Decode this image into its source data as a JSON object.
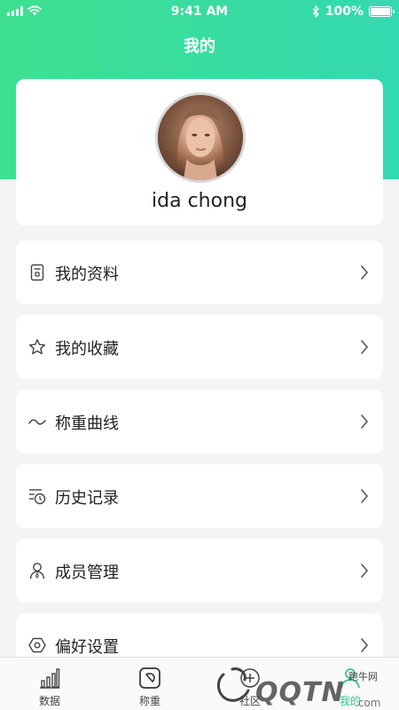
{
  "status_bar": {
    "time": "9:41 AM",
    "battery": "100%",
    "battery_level": 1.0
  },
  "header": {
    "title": "我的"
  },
  "profile": {
    "username": "ida chong"
  },
  "menu": [
    {
      "label": "我的资料",
      "icon": "profile-document-icon"
    },
    {
      "label": "我的收藏",
      "icon": "star-icon"
    },
    {
      "label": "称重曲线",
      "icon": "wave-curve-icon"
    },
    {
      "label": "历史记录",
      "icon": "history-clock-icon"
    },
    {
      "label": "成员管理",
      "icon": "person-icon"
    },
    {
      "label": "偏好设置",
      "icon": "hexagon-settings-icon"
    }
  ],
  "tabbar": {
    "tabs": [
      {
        "label": "数据",
        "icon": "bar-chart-icon"
      },
      {
        "label": "称重",
        "icon": "scale-icon"
      },
      {
        "label": "社区",
        "icon": "community-icon"
      },
      {
        "label": "我的",
        "icon": "user-icon"
      }
    ],
    "active_index": 3
  },
  "watermark": {
    "text": "跑牛网",
    "brand": "QQTN"
  },
  "colors": {
    "accent": "#36c78a",
    "gradient_start": "#3ee08f",
    "gradient_end": "#33d9b0"
  }
}
